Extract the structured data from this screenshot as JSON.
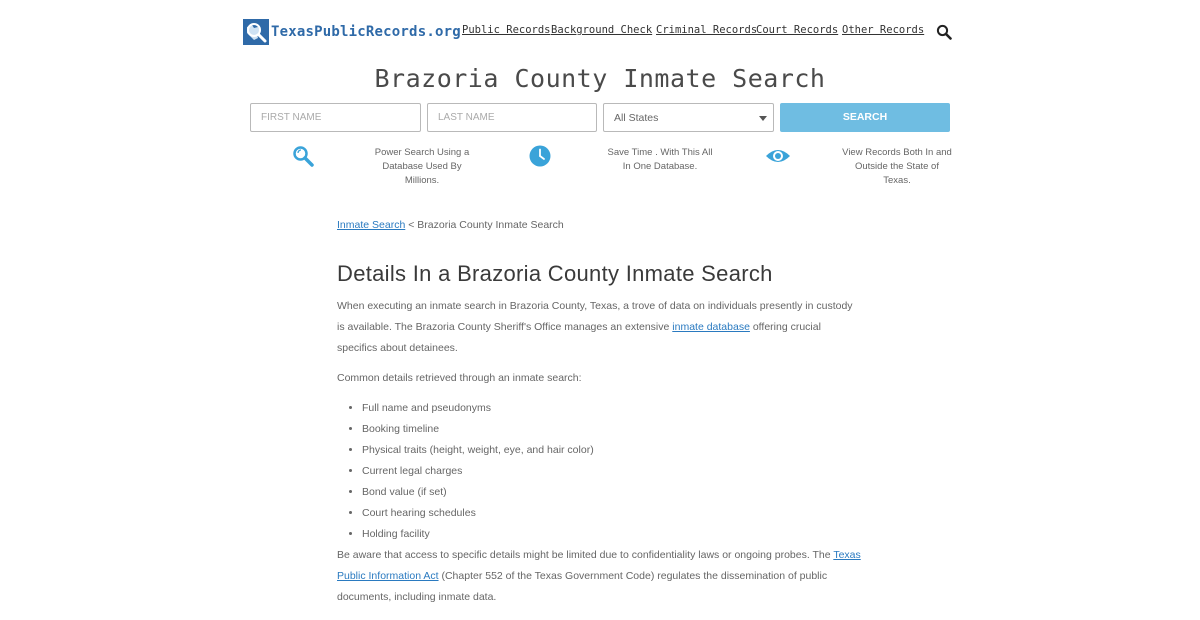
{
  "header": {
    "logo_text": "TexasPublicRecords.org",
    "nav": [
      "Public Records",
      "Background Check",
      "Criminal Records",
      "Court Records",
      "Other Records"
    ]
  },
  "page_title": "Brazoria County Inmate Search",
  "form": {
    "first_name_placeholder": "FIRST NAME",
    "last_name_placeholder": "LAST NAME",
    "state_selected": "All States",
    "search_label": "Search"
  },
  "features": [
    {
      "icon": "magnifier-icon",
      "text": "Power Search Using a Database Used By Millions."
    },
    {
      "icon": "clock-icon",
      "text": "Save Time . With This All In One Database."
    },
    {
      "icon": "eye-icon",
      "text": "View Records Both In and Outside the State of Texas."
    }
  ],
  "breadcrumb": {
    "link": "Inmate Search",
    "current": "Brazoria County Inmate Search",
    "separator": "<"
  },
  "section_title": "Details In a Brazoria County Inmate Search",
  "intro": {
    "part1": "When executing an inmate search in Brazoria County, Texas, a trove of data on individuals presently in custody is available. The Brazoria County Sheriff's Office manages an extensive ",
    "link": "inmate database",
    "part2": " offering crucial specifics about detainees."
  },
  "list_intro": "Common details retrieved through an inmate search:",
  "details": [
    "Full name and pseudonyms",
    "Booking timeline",
    "Physical traits (height, weight, eye, and hair color)",
    "Current legal charges",
    "Bond value (if set)",
    "Court hearing schedules",
    "Holding facility"
  ],
  "note": {
    "part1": "Be aware that access to specific details might be limited due to confidentiality laws or ongoing probes. The ",
    "link": "Texas Public Information Act",
    "part2": " (Chapter 552 of the Texas Government Code) regulates the dissemination of public documents, including inmate data."
  },
  "colors": {
    "brand": "#2f6aa8",
    "accent": "#6fbde2",
    "link": "#2a7ac0"
  }
}
